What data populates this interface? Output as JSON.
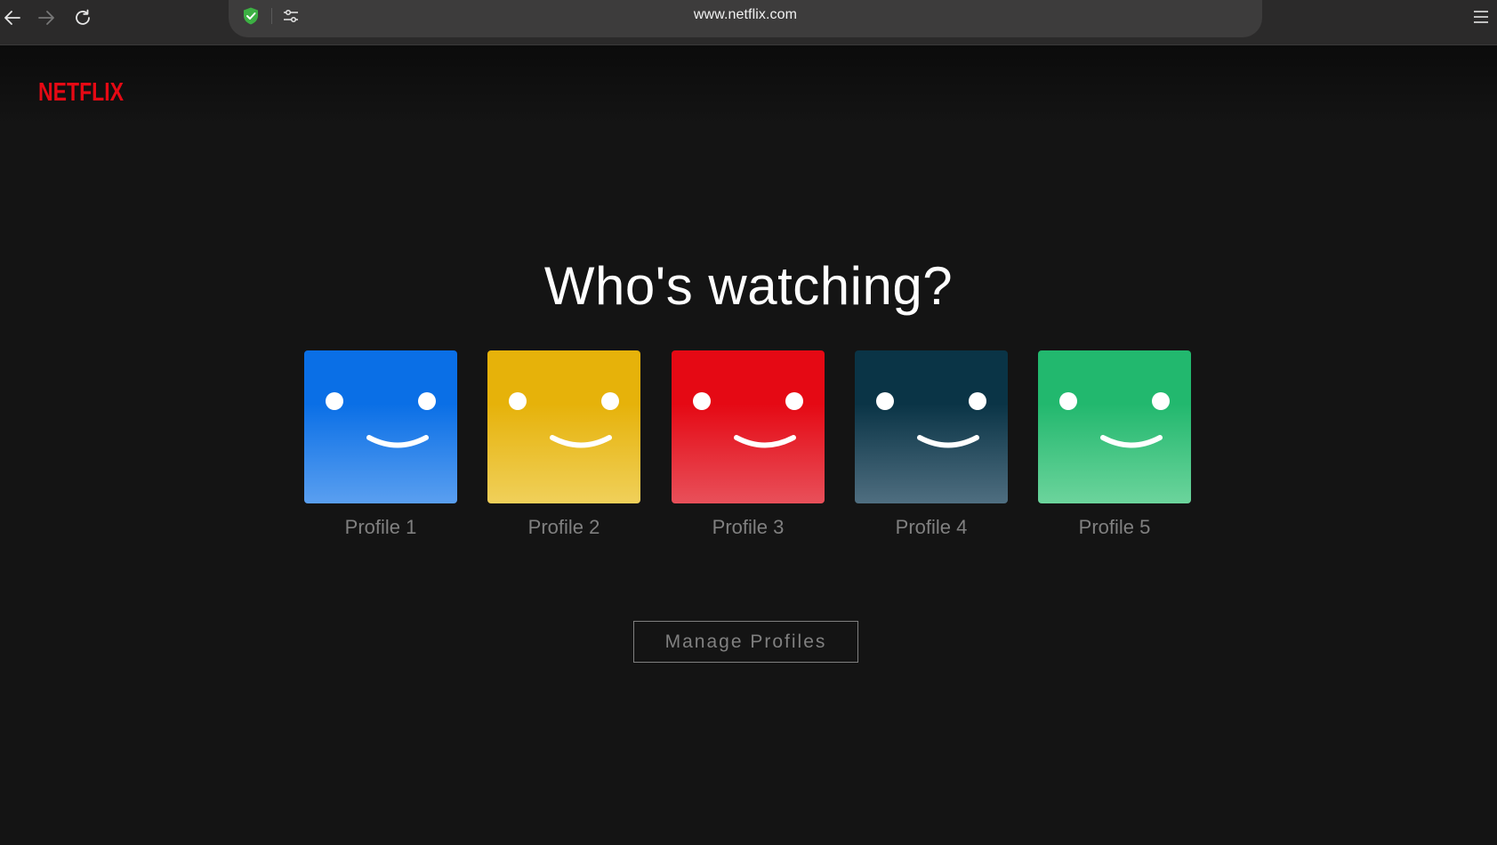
{
  "browser": {
    "url": "www.netflix.com",
    "back_icon": "arrow-left-icon",
    "forward_icon": "arrow-right-icon",
    "reload_icon": "reload-icon",
    "shield_icon": "shield-check-icon",
    "site_settings_icon": "sliders-icon",
    "menu_icon": "hamburger-menu-icon",
    "shield_color": "#3cb043"
  },
  "header": {
    "logo_text": "NETFLIX",
    "logo_color": "#e50914"
  },
  "main": {
    "title": "Who's watching?",
    "profiles": [
      {
        "name": "Profile 1",
        "color_top": "#0a6fe6",
        "color_bottom": "#5a9ff0"
      },
      {
        "name": "Profile 2",
        "color_top": "#e6b20a",
        "color_bottom": "#f0d05a"
      },
      {
        "name": "Profile 3",
        "color_top": "#e50914",
        "color_bottom": "#e8505a"
      },
      {
        "name": "Profile 4",
        "color_top": "#0a3446",
        "color_bottom": "#4f6e80"
      },
      {
        "name": "Profile 5",
        "color_top": "#22b86e",
        "color_bottom": "#6cd49c"
      }
    ],
    "manage_button": "Manage Profiles"
  }
}
